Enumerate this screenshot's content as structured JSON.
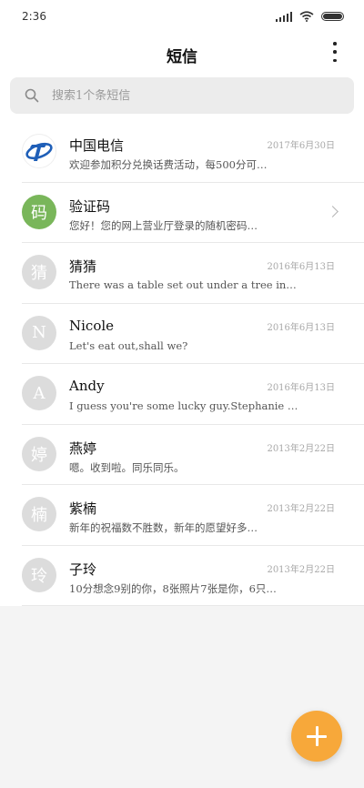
{
  "status_bar": {
    "time": "2:36"
  },
  "header": {
    "title": "短信"
  },
  "search": {
    "placeholder": "搜索1个条短信"
  },
  "conversations": [
    {
      "name": "中国电信",
      "time": "2017年6月30日",
      "snippet": "欢迎参加积分兑换话费活动，每500分可…",
      "avatar_type": "telecom",
      "avatar_text": "",
      "has_chevron": false
    },
    {
      "name": "验证码",
      "time": "",
      "snippet": "您好！您的网上营业厅登录的随机密码…",
      "avatar_type": "green",
      "avatar_text": "码",
      "has_chevron": true
    },
    {
      "name": "猜猜",
      "time": "2016年6月13日",
      "snippet": "There was a table set out under a tree in front o…",
      "avatar_type": "gray",
      "avatar_text": "猜",
      "has_chevron": false
    },
    {
      "name": "Nicole",
      "time": "2016年6月13日",
      "snippet": "Let's eat out,shall we?",
      "avatar_type": "gray",
      "avatar_text": "N",
      "has_chevron": false
    },
    {
      "name": "Andy",
      "time": "2016年6月13日",
      "snippet": "I guess you're some lucky guy.Stephanie is a nice g…",
      "avatar_type": "gray",
      "avatar_text": "A",
      "has_chevron": false
    },
    {
      "name": "燕婷",
      "time": "2013年2月22日",
      "snippet": "嗯。收到啦。同乐同乐。",
      "avatar_type": "gray",
      "avatar_text": "婷",
      "has_chevron": false
    },
    {
      "name": "紫楠",
      "time": "2013年2月22日",
      "snippet": "新年的祝福数不胜数，新年的愿望好多…",
      "avatar_type": "gray",
      "avatar_text": "楠",
      "has_chevron": false
    },
    {
      "name": "子玲",
      "time": "2013年2月22日",
      "snippet": "10分想念9别的你，8张照片7张是你，6只…",
      "avatar_type": "gray",
      "avatar_text": "玲",
      "has_chevron": false
    }
  ],
  "colors": {
    "fab": "#f7a83a",
    "avatar_green": "#79b65a",
    "avatar_gray": "#dcdcdc",
    "telecom_blue": "#1f5fb8"
  },
  "icons": {
    "search": "search-icon",
    "more": "more-vert-icon",
    "compose": "plus-icon",
    "chevron": "chevron-right-icon"
  }
}
